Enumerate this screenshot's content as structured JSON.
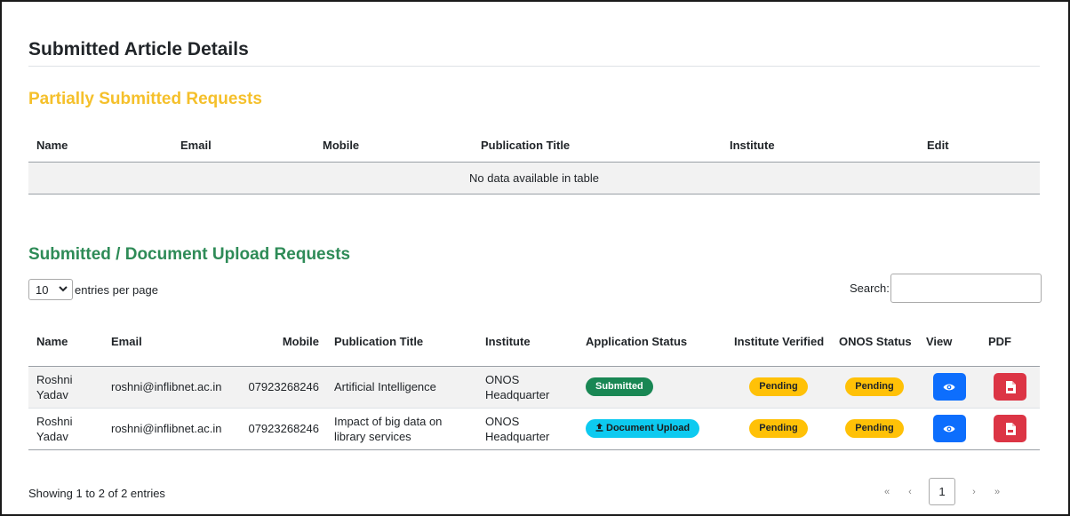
{
  "page": {
    "title": "Submitted Article Details"
  },
  "partial": {
    "heading": "Partially Submitted Requests",
    "columns": [
      "Name",
      "Email",
      "Mobile",
      "Publication Title",
      "Institute",
      "Edit"
    ],
    "empty_message": "No data available in table"
  },
  "submitted": {
    "heading": "Submitted / Document Upload Requests",
    "entries_value": "10",
    "entries_label": "entries per page",
    "search_label": "Search:",
    "search_value": "",
    "columns": {
      "name": "Name",
      "email": "Email",
      "mobile": "Mobile",
      "title": "Publication Title",
      "institute": "Institute",
      "app_status": "Application Status",
      "inst_verified": "Institute Verified",
      "onos_status": "ONOS Status",
      "view": "View",
      "pdf": "PDF"
    },
    "rows": [
      {
        "name": "Roshni Yadav",
        "email": "roshni@inflibnet.ac.in",
        "mobile": "07923268246",
        "title": "Artificial Intelligence",
        "institute": "ONOS Headquarter",
        "app_status": "Submitted",
        "app_status_color": "#198754",
        "inst_verified": "Pending",
        "onos_status": "Pending"
      },
      {
        "name": "Roshni Yadav",
        "email": "roshni@inflibnet.ac.in",
        "mobile": "07923268246",
        "title": "Impact of big data on library services",
        "institute": "ONOS Headquarter",
        "app_status": "Document Upload",
        "app_status_color": "#0dcaf0",
        "app_status_icon": "upload-icon",
        "inst_verified": "Pending",
        "onos_status": "Pending"
      }
    ],
    "footer_info": "Showing 1 to 2 of 2 entries",
    "pagination": {
      "first": "«",
      "prev": "‹",
      "current": "1",
      "next": "›",
      "last": "»"
    }
  },
  "colors": {
    "partial_heading": "#f5c02b",
    "submitted_heading": "#2e8b57",
    "pending_badge": "#ffc107",
    "view_button": "#0d6efd",
    "pdf_button": "#dc3545"
  },
  "icons": {
    "view": "eye-icon",
    "pdf": "pdf-file-icon",
    "select": "chevron-down-icon"
  }
}
